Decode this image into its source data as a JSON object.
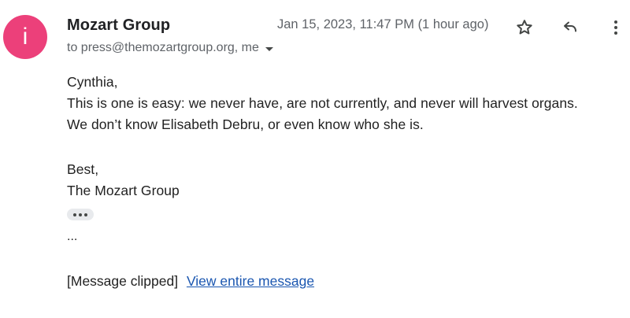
{
  "sender": {
    "avatar_letter": "i",
    "avatar_color": "#ec407a",
    "name": "Mozart Group"
  },
  "meta": {
    "date": "Jan 15, 2023, 11:47 PM (1 hour ago)",
    "recipients": "to press@themozartgroup.org, me"
  },
  "icons": {
    "star": "star-icon",
    "reply": "reply-icon",
    "more": "more-vert-icon",
    "recipients_dropdown": "caret-down-icon",
    "show_trimmed": "ellipsis-icon"
  },
  "message": {
    "greeting": "Cynthia,",
    "line1": "This is one is easy: we never have, are not currently, and never will harvest organs.",
    "line2": "We don’t know Elisabeth Debru, or even know who she is.",
    "signoff": "Best,",
    "signature": "The Mozart Group",
    "trailing": "..."
  },
  "footer": {
    "clipped_label": "[Message clipped]",
    "view_link": "View entire message",
    "link_color": "#1a56b0"
  }
}
